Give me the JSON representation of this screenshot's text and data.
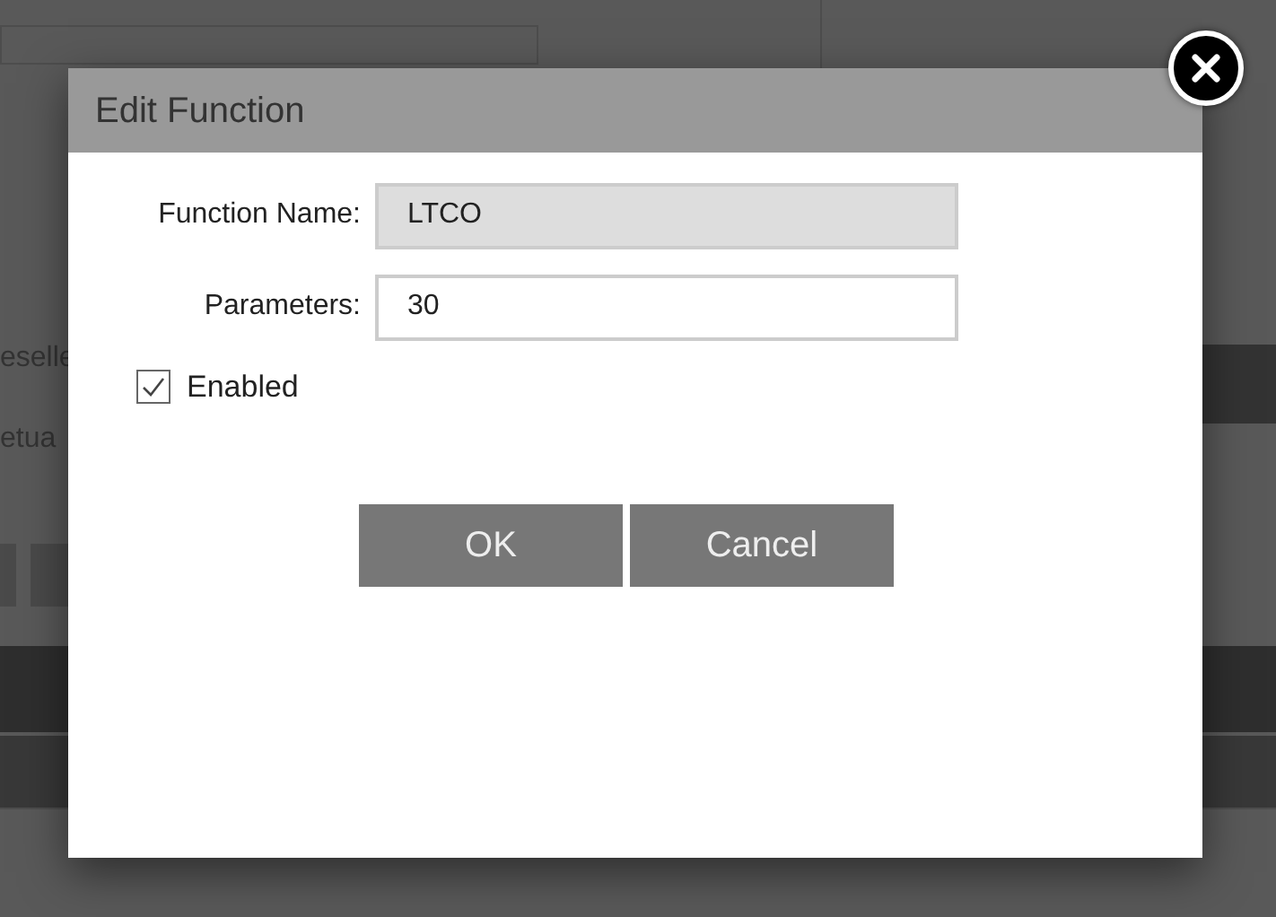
{
  "background": {
    "texts": [
      "eselle",
      "etua"
    ]
  },
  "dialog": {
    "title": "Edit Function",
    "fields": [
      {
        "label": "Function Name:",
        "value": "LTCO",
        "disabled": true
      },
      {
        "label": "Parameters:",
        "value": "30",
        "disabled": false
      }
    ],
    "checkbox": {
      "label": "Enabled",
      "checked": true
    },
    "buttons": [
      "OK",
      "Cancel"
    ]
  }
}
